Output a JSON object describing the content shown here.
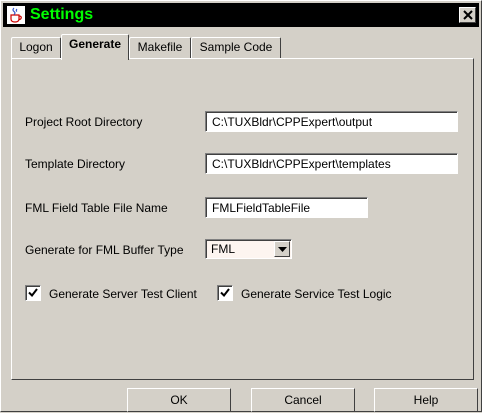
{
  "window": {
    "title": "Settings",
    "title_color": "#00ff00",
    "titlebar_color": "#000000",
    "app_icon": "java-cup-icon",
    "close_icon": "close-icon"
  },
  "tabs": [
    {
      "label": "Logon",
      "active": false
    },
    {
      "label": "Generate",
      "active": true
    },
    {
      "label": "Makefile",
      "active": false
    },
    {
      "label": "Sample Code",
      "active": false
    }
  ],
  "form": {
    "project_root": {
      "label": "Project Root Directory",
      "value": "C:\\TUXBldr\\CPPExpert\\output"
    },
    "template_dir": {
      "label": "Template Directory",
      "value": "C:\\TUXBldr\\CPPExpert\\templates"
    },
    "fml_table": {
      "label": "FML Field Table File Name",
      "value": "FMLFieldTableFile"
    },
    "buffer_type": {
      "label": "Generate for FML Buffer Type",
      "selected": "FML",
      "icon": "chevron-down-icon"
    },
    "server_test_client": {
      "label": "Generate Server Test Client",
      "checked": true
    },
    "service_test_logic": {
      "label": "Generate Service Test Logic",
      "checked": true
    }
  },
  "buttons": {
    "ok": "OK",
    "cancel": "Cancel",
    "help": "Help"
  }
}
